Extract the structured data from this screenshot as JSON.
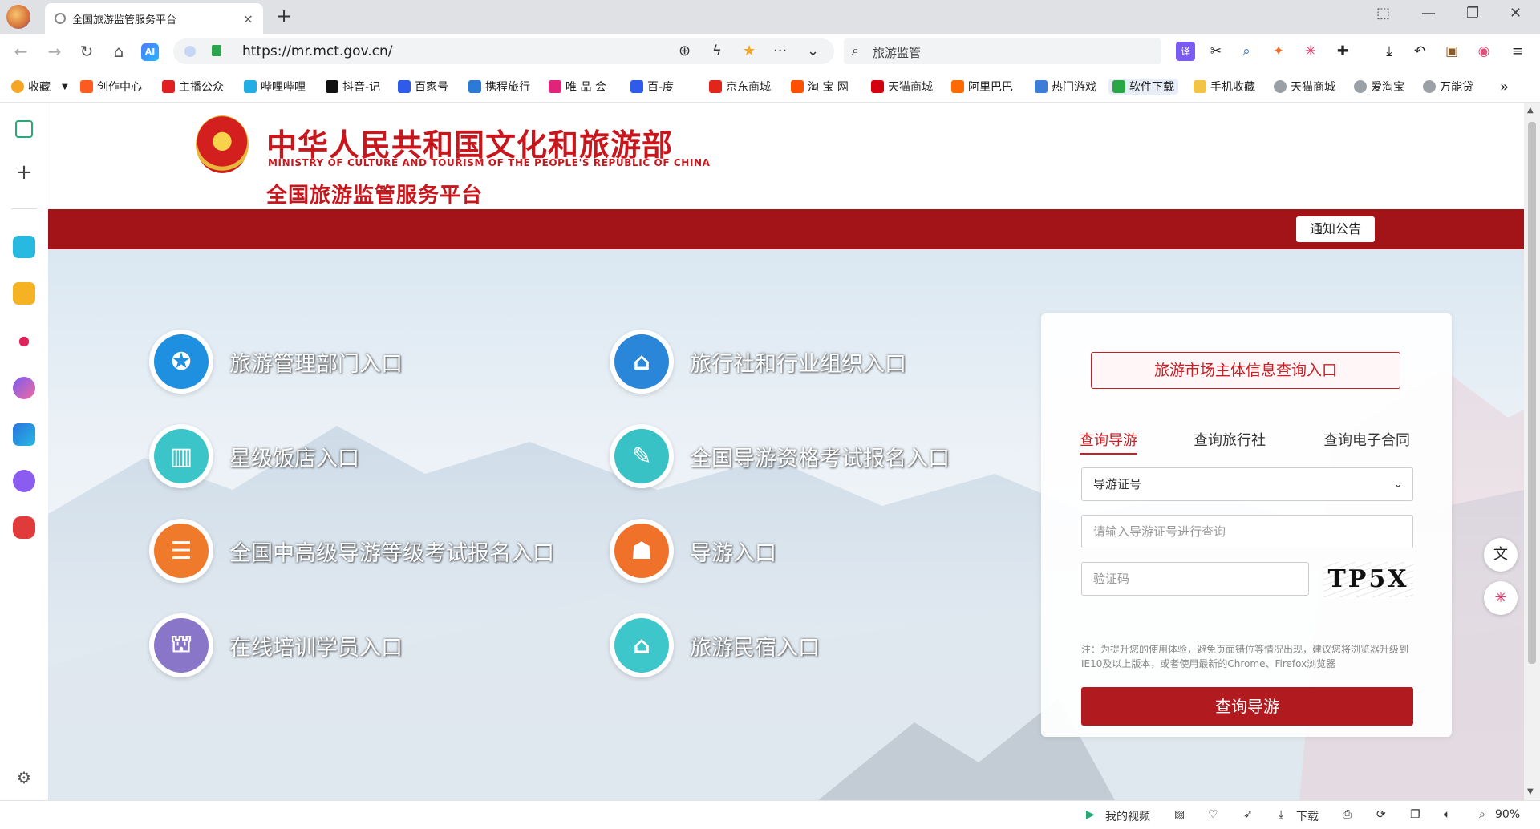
{
  "tab": {
    "title": "全国旅游监管服务平台",
    "close": "×"
  },
  "new_tab": "+",
  "window_controls": {
    "pin": "⬚",
    "minimize": "—",
    "restore": "❐",
    "close": "✕"
  },
  "nav": {
    "back": "←",
    "forward": "→",
    "reload": "↻",
    "home": "⌂",
    "ai": "AI"
  },
  "url": "https://mr.mct.gov.cn/",
  "search": {
    "value": "旅游监管"
  },
  "bookmarks": [
    {
      "label": "收藏",
      "color": "#f5a623"
    },
    {
      "label": "创作中心",
      "color": "#ff5a1f"
    },
    {
      "label": "主播公众",
      "color": "#e02020"
    },
    {
      "label": "哔哩哔哩",
      "color": "#23ade5"
    },
    {
      "label": "抖音-记",
      "color": "#111111"
    },
    {
      "label": "百家号",
      "color": "#2f5bea"
    },
    {
      "label": "携程旅行",
      "color": "#2a7bd6"
    },
    {
      "label": "唯 品 会",
      "color": "#e0247a"
    },
    {
      "label": "百-度",
      "color": "#2f5bea"
    },
    {
      "label": "京东商城",
      "color": "#e1251b"
    },
    {
      "label": "淘 宝 网",
      "color": "#ff5000"
    },
    {
      "label": "天猫商城",
      "color": "#d3000f"
    },
    {
      "label": "阿里巴巴",
      "color": "#ff6a00"
    },
    {
      "label": "热门游戏",
      "color": "#3b7dd8"
    },
    {
      "label": "软件下载",
      "color": "#29a745"
    },
    {
      "label": "手机收藏",
      "color": "#f3c443"
    },
    {
      "label": "天猫商城",
      "color": "#9aa0a6"
    },
    {
      "label": "爱淘宝",
      "color": "#9aa0a6"
    },
    {
      "label": "万能贷",
      "color": "#9aa0a6"
    }
  ],
  "bookmarks_more": "»",
  "header": {
    "org_cn": "中华人民共和国文化和旅游部",
    "org_en": "MINISTRY OF CULTURE AND TOURISM OF THE PEOPLE'S REPUBLIC OF CHINA",
    "platform": "全国旅游监管服务平台",
    "notice_button": "通知公告"
  },
  "entries": [
    {
      "label": "旅游管理部门入口",
      "color": "#1f8fe0"
    },
    {
      "label": "旅行社和行业组织入口",
      "color": "#2a86d8"
    },
    {
      "label": "星级饭店入口",
      "color": "#3cc5c8"
    },
    {
      "label": "全国导游资格考试报名入口",
      "color": "#38c2c6"
    },
    {
      "label": "全国中高级导游等级考试报名入口",
      "color": "#f07a2b"
    },
    {
      "label": "导游入口",
      "color": "#f0722a"
    },
    {
      "label": "在线培训学员入口",
      "color": "#8a76c8"
    },
    {
      "label": "旅游民宿入口",
      "color": "#3ec7cb"
    }
  ],
  "panel": {
    "market_button": "旅游市场主体信息查询入口",
    "tabs": [
      "查询导游",
      "查询旅行社",
      "查询电子合同"
    ],
    "select_value": "导游证号",
    "cert_placeholder": "请输入导游证号进行查询",
    "captcha_placeholder": "验证码",
    "captcha_text": "TP5X",
    "note": "注：为提升您的使用体验，避免页面错位等情况出现，建议您将浏览器升级到IE10及以上版本，或者使用最新的Chrome、Firefox浏览器",
    "submit": "查询导游"
  },
  "status": {
    "my_video": "我的视频",
    "download": "下载",
    "zoom": "90%"
  }
}
